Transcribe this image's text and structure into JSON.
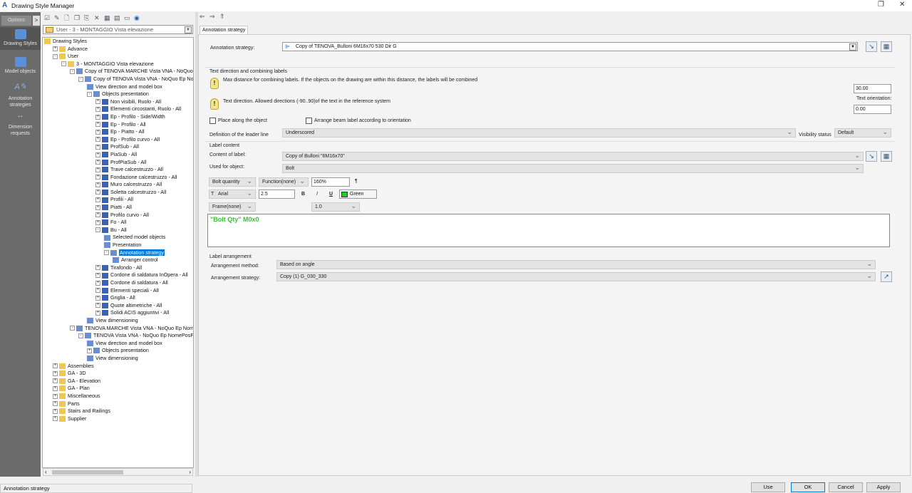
{
  "window": {
    "title": "Drawing Style Manager"
  },
  "left_bar": {
    "options_label": "Options",
    "options_arrow": ">",
    "items": [
      {
        "label": "Drawing Styles",
        "selected": true
      },
      {
        "label": "Model objects"
      },
      {
        "label": "Annotation strategies"
      },
      {
        "label": "Dimension requests"
      }
    ]
  },
  "style_combo": {
    "value": "User - 3 - MONTAGGIO Vista elevazione"
  },
  "tree": [
    {
      "label": "Drawing Styles",
      "level": 0,
      "exp": ""
    },
    {
      "label": "Advance",
      "level": 1,
      "exp": "+"
    },
    {
      "label": "User",
      "level": 1,
      "exp": "−"
    },
    {
      "label": "3 - MONTAGGIO Vista elevazione",
      "level": 2,
      "exp": "−"
    },
    {
      "label": "Copy of TENOVA MARCHE Vista VNA - NoQuo E",
      "level": 3,
      "exp": "−"
    },
    {
      "label": "Copy of TENOVA Vista VNA - NoQuo Ep Nor",
      "level": 4,
      "exp": "−"
    },
    {
      "label": "View direction and model box",
      "level": 5,
      "exp": ""
    },
    {
      "label": "Objects presentation",
      "level": 5,
      "exp": "−"
    },
    {
      "label": "Non visibili, Ruolo - All",
      "level": 6,
      "exp": "+"
    },
    {
      "label": "Elementi circostanti, Ruolo - All",
      "level": 6,
      "exp": "+"
    },
    {
      "label": "Ep - Profilo - Side/Width",
      "level": 6,
      "exp": "+"
    },
    {
      "label": "Ep - Profilo - All",
      "level": 6,
      "exp": "+"
    },
    {
      "label": "Ep - Piatto - All",
      "level": 6,
      "exp": "+"
    },
    {
      "label": "Ep - Profilo curvo - All",
      "level": 6,
      "exp": "+"
    },
    {
      "label": "ProfSub - All",
      "level": 6,
      "exp": "+"
    },
    {
      "label": "PiaSub - All",
      "level": 6,
      "exp": "+"
    },
    {
      "label": "ProfPiaSub - All",
      "level": 6,
      "exp": "+"
    },
    {
      "label": "Trave calcestruzzo - All",
      "level": 6,
      "exp": "+"
    },
    {
      "label": "Fondazione calcestruzzo - All",
      "level": 6,
      "exp": "+"
    },
    {
      "label": "Muro calcestruzzo - All",
      "level": 6,
      "exp": "+"
    },
    {
      "label": "Soletta calcestruzzo - All",
      "level": 6,
      "exp": "+"
    },
    {
      "label": "Profili - All",
      "level": 6,
      "exp": "+"
    },
    {
      "label": "Piatti - All",
      "level": 6,
      "exp": "+"
    },
    {
      "label": "Profilo curvo - All",
      "level": 6,
      "exp": "+"
    },
    {
      "label": "Fo - All",
      "level": 6,
      "exp": "+"
    },
    {
      "label": "Bu - All",
      "level": 6,
      "exp": "−"
    },
    {
      "label": "Selected model objects",
      "level": 7,
      "exp": ""
    },
    {
      "label": "Presentation",
      "level": 7,
      "exp": ""
    },
    {
      "label": "Annotation strategy",
      "level": 7,
      "exp": "−",
      "selected": true
    },
    {
      "label": "Arranger control",
      "level": 8,
      "exp": ""
    },
    {
      "label": "Tirafondo - All",
      "level": 6,
      "exp": "+"
    },
    {
      "label": "Cordone di saldatura InOpera - All",
      "level": 6,
      "exp": "+"
    },
    {
      "label": "Cordone di saldatura - All",
      "level": 6,
      "exp": "+"
    },
    {
      "label": "Elementi speciali - All",
      "level": 6,
      "exp": "+"
    },
    {
      "label": "Griglia - All",
      "level": 6,
      "exp": "+"
    },
    {
      "label": "Quote altimetriche - All",
      "level": 6,
      "exp": "+"
    },
    {
      "label": "Solidi ACIS aggiuntivi - All",
      "level": 6,
      "exp": "+"
    },
    {
      "label": "View dimensioning",
      "level": 5,
      "exp": ""
    },
    {
      "label": "TENOVA MARCHE Vista VNA - NoQuo Ep Nome",
      "level": 3,
      "exp": "−"
    },
    {
      "label": "TENOVA Vista VNA - NoQuo Ep NomePosPi",
      "level": 4,
      "exp": "−"
    },
    {
      "label": "View direction and model box",
      "level": 5,
      "exp": ""
    },
    {
      "label": "Objects presentation",
      "level": 5,
      "exp": "+"
    },
    {
      "label": "View dimensioning",
      "level": 5,
      "exp": ""
    },
    {
      "label": "Assemblies",
      "level": 1,
      "exp": "+"
    },
    {
      "label": "GA - 3D",
      "level": 1,
      "exp": "+"
    },
    {
      "label": "GA - Elevation",
      "level": 1,
      "exp": "+"
    },
    {
      "label": "GA - Plan",
      "level": 1,
      "exp": "+"
    },
    {
      "label": "Miscellaneous",
      "level": 1,
      "exp": "+"
    },
    {
      "label": "Parts",
      "level": 1,
      "exp": "+"
    },
    {
      "label": "Stairs and Railings",
      "level": 1,
      "exp": "+"
    },
    {
      "label": "Supplier",
      "level": 1,
      "exp": "+"
    }
  ],
  "status_bar": {
    "text": "Annotation strategy"
  },
  "tab": {
    "label": "Annotation strategy"
  },
  "form": {
    "annotation_strategy_label": "Annotation strategy:",
    "annotation_strategy_value": "Copy of TENOVA_Bulloni 6M16x70 530 Dir G",
    "text_dir_group": "Text direction and combining labels",
    "max_distance_hint": "Max distance for combining labels. If the objects on the drawing are within this distance, the labels will be combined",
    "max_distance_value": "30.00",
    "text_direction_hint": "Text direction. Allowed directions (-90..90)of the text in the reference system",
    "text_orientation_label": "Text orientation:",
    "text_orientation_value": "0.00",
    "place_along_label": "Place along the object",
    "place_along_checked": false,
    "arrange_beam_label": "Arrange beam label according to orientation",
    "arrange_beam_checked": false,
    "leader_line_label": "Definition of the leader line",
    "leader_line_value": "Underscored",
    "visibility_label": "Visibility status",
    "visibility_value": "Default",
    "label_content_group": "Label content",
    "content_label": "Content of label:",
    "content_value": "Copy of Bulloni \"6M16x70\"",
    "used_for_label": "Used for object:",
    "used_for_value": "Bolt",
    "property_value": "Bolt quantity",
    "function_value": "Function(none)",
    "scale_value": "160%",
    "pilcrow": "¶",
    "font_value": "Arial",
    "size_value": "2.5",
    "bold": "B",
    "italic": "I",
    "underline": "U",
    "color_value": "Green",
    "color_hex": "#22cc22",
    "frame_value": "Frame(none)",
    "frame_factor": "1.0",
    "editor_text": "\"Bolt Qty\" M0x0",
    "arrangement_group": "Label arrangement",
    "arr_method_label": "Arrangement method:",
    "arr_method_value": "Based on angle",
    "arr_strategy_label": "Arrangement strategy:",
    "arr_strategy_value": "Copy (1) G_030_330"
  },
  "buttons": {
    "use": "Use",
    "ok": "OK",
    "cancel": "Cancel",
    "apply": "Apply"
  }
}
